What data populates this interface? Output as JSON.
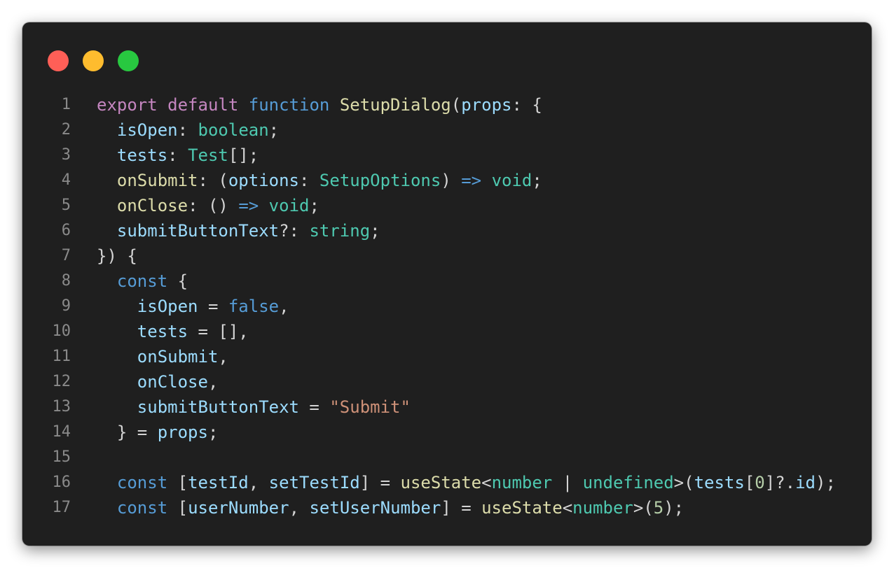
{
  "window": {
    "controls": [
      {
        "name": "close-button",
        "color": "#ff5f57"
      },
      {
        "name": "minimize-button",
        "color": "#febc2e"
      },
      {
        "name": "zoom-button",
        "color": "#28c840"
      }
    ]
  },
  "code": {
    "lines": [
      {
        "num": "1",
        "tokens": [
          {
            "t": "export",
            "c": "kw-purple"
          },
          {
            "t": " ",
            "c": "punct"
          },
          {
            "t": "default",
            "c": "kw-purple"
          },
          {
            "t": " ",
            "c": "punct"
          },
          {
            "t": "function",
            "c": "kw-blue"
          },
          {
            "t": " ",
            "c": "punct"
          },
          {
            "t": "SetupDialog",
            "c": "fn"
          },
          {
            "t": "(",
            "c": "punct"
          },
          {
            "t": "props",
            "c": "var"
          },
          {
            "t": ": {",
            "c": "punct"
          }
        ]
      },
      {
        "num": "2",
        "tokens": [
          {
            "t": "  ",
            "c": "punct"
          },
          {
            "t": "isOpen",
            "c": "var"
          },
          {
            "t": ": ",
            "c": "punct"
          },
          {
            "t": "boolean",
            "c": "type"
          },
          {
            "t": ";",
            "c": "punct"
          }
        ]
      },
      {
        "num": "3",
        "tokens": [
          {
            "t": "  ",
            "c": "punct"
          },
          {
            "t": "tests",
            "c": "var"
          },
          {
            "t": ": ",
            "c": "punct"
          },
          {
            "t": "Test",
            "c": "type"
          },
          {
            "t": "[];",
            "c": "punct"
          }
        ]
      },
      {
        "num": "4",
        "tokens": [
          {
            "t": "  ",
            "c": "punct"
          },
          {
            "t": "onSubmit",
            "c": "fn"
          },
          {
            "t": ": (",
            "c": "punct"
          },
          {
            "t": "options",
            "c": "var"
          },
          {
            "t": ": ",
            "c": "punct"
          },
          {
            "t": "SetupOptions",
            "c": "type"
          },
          {
            "t": ") ",
            "c": "punct"
          },
          {
            "t": "=>",
            "c": "op"
          },
          {
            "t": " ",
            "c": "punct"
          },
          {
            "t": "void",
            "c": "type"
          },
          {
            "t": ";",
            "c": "punct"
          }
        ]
      },
      {
        "num": "5",
        "tokens": [
          {
            "t": "  ",
            "c": "punct"
          },
          {
            "t": "onClose",
            "c": "fn"
          },
          {
            "t": ": () ",
            "c": "punct"
          },
          {
            "t": "=>",
            "c": "op"
          },
          {
            "t": " ",
            "c": "punct"
          },
          {
            "t": "void",
            "c": "type"
          },
          {
            "t": ";",
            "c": "punct"
          }
        ]
      },
      {
        "num": "6",
        "tokens": [
          {
            "t": "  ",
            "c": "punct"
          },
          {
            "t": "submitButtonText",
            "c": "var"
          },
          {
            "t": "?: ",
            "c": "punct"
          },
          {
            "t": "string",
            "c": "type"
          },
          {
            "t": ";",
            "c": "punct"
          }
        ]
      },
      {
        "num": "7",
        "tokens": [
          {
            "t": "}) {",
            "c": "punct"
          }
        ]
      },
      {
        "num": "8",
        "tokens": [
          {
            "t": "  ",
            "c": "punct"
          },
          {
            "t": "const",
            "c": "kw-blue"
          },
          {
            "t": " {",
            "c": "punct"
          }
        ]
      },
      {
        "num": "9",
        "tokens": [
          {
            "t": "    ",
            "c": "punct"
          },
          {
            "t": "isOpen",
            "c": "var"
          },
          {
            "t": " = ",
            "c": "punct"
          },
          {
            "t": "false",
            "c": "kw-blue"
          },
          {
            "t": ",",
            "c": "punct"
          }
        ]
      },
      {
        "num": "10",
        "tokens": [
          {
            "t": "    ",
            "c": "punct"
          },
          {
            "t": "tests",
            "c": "var"
          },
          {
            "t": " = [],",
            "c": "punct"
          }
        ]
      },
      {
        "num": "11",
        "tokens": [
          {
            "t": "    ",
            "c": "punct"
          },
          {
            "t": "onSubmit",
            "c": "var"
          },
          {
            "t": ",",
            "c": "punct"
          }
        ]
      },
      {
        "num": "12",
        "tokens": [
          {
            "t": "    ",
            "c": "punct"
          },
          {
            "t": "onClose",
            "c": "var"
          },
          {
            "t": ",",
            "c": "punct"
          }
        ]
      },
      {
        "num": "13",
        "tokens": [
          {
            "t": "    ",
            "c": "punct"
          },
          {
            "t": "submitButtonText",
            "c": "var"
          },
          {
            "t": " = ",
            "c": "punct"
          },
          {
            "t": "\"Submit\"",
            "c": "str"
          }
        ]
      },
      {
        "num": "14",
        "tokens": [
          {
            "t": "  } = ",
            "c": "punct"
          },
          {
            "t": "props",
            "c": "var"
          },
          {
            "t": ";",
            "c": "punct"
          }
        ]
      },
      {
        "num": "15",
        "tokens": []
      },
      {
        "num": "16",
        "tokens": [
          {
            "t": "  ",
            "c": "punct"
          },
          {
            "t": "const",
            "c": "kw-blue"
          },
          {
            "t": " [",
            "c": "punct"
          },
          {
            "t": "testId",
            "c": "var"
          },
          {
            "t": ", ",
            "c": "punct"
          },
          {
            "t": "setTestId",
            "c": "var"
          },
          {
            "t": "] = ",
            "c": "punct"
          },
          {
            "t": "useState",
            "c": "fn"
          },
          {
            "t": "<",
            "c": "punct"
          },
          {
            "t": "number",
            "c": "type"
          },
          {
            "t": " | ",
            "c": "punct"
          },
          {
            "t": "undefined",
            "c": "type"
          },
          {
            "t": ">(",
            "c": "punct"
          },
          {
            "t": "tests",
            "c": "var"
          },
          {
            "t": "[",
            "c": "punct"
          },
          {
            "t": "0",
            "c": "num"
          },
          {
            "t": "]?.",
            "c": "punct"
          },
          {
            "t": "id",
            "c": "var"
          },
          {
            "t": ");",
            "c": "punct"
          }
        ]
      },
      {
        "num": "17",
        "tokens": [
          {
            "t": "  ",
            "c": "punct"
          },
          {
            "t": "const",
            "c": "kw-blue"
          },
          {
            "t": " [",
            "c": "punct"
          },
          {
            "t": "userNumber",
            "c": "var"
          },
          {
            "t": ", ",
            "c": "punct"
          },
          {
            "t": "setUserNumber",
            "c": "var"
          },
          {
            "t": "] = ",
            "c": "punct"
          },
          {
            "t": "useState",
            "c": "fn"
          },
          {
            "t": "<",
            "c": "punct"
          },
          {
            "t": "number",
            "c": "type"
          },
          {
            "t": ">(",
            "c": "punct"
          },
          {
            "t": "5",
            "c": "num"
          },
          {
            "t": ");",
            "c": "punct"
          }
        ]
      }
    ]
  }
}
